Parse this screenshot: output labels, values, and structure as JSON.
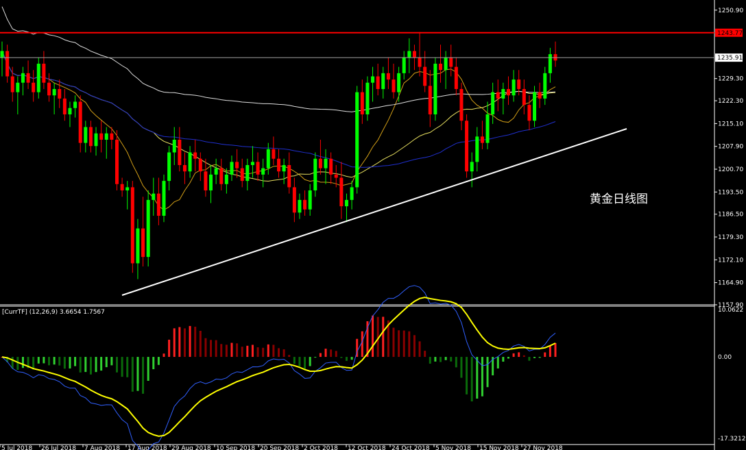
{
  "chart_data": [
    {
      "type": "candlestick",
      "annotation": "黄金日线图",
      "y_ticks": [
        "1250.90",
        "1243.77",
        "1235.91",
        "1229.30",
        "1222.30",
        "1215.10",
        "1207.90",
        "1200.70",
        "1193.50",
        "1186.50",
        "1179.30",
        "1172.10",
        "1164.90",
        "1157.90"
      ],
      "ylim": [
        1157.9,
        1254.1
      ],
      "resistance_level": 1243.77,
      "resistance_label": "1243.77",
      "current_price": 1235.91,
      "current_label": "1235.91",
      "x_labels": [
        "5 Jul 2018",
        "26 Jul 2018",
        "7 Aug 2018",
        "17 Aug 2018",
        "29 Aug 2018",
        "10 Sep 2018",
        "20 Sep 2018",
        "2 Oct 2018",
        "12 Oct 2018",
        "24 Oct 2018",
        "5 Nov 2018",
        "15 Nov 2018",
        "27 Nov 2018"
      ],
      "candles": [
        [
          1236,
          1241,
          1230,
          1238
        ],
        [
          1238,
          1240,
          1228,
          1230
        ],
        [
          1230,
          1233,
          1222,
          1225
        ],
        [
          1225,
          1230,
          1218,
          1228
        ],
        [
          1228,
          1233,
          1224,
          1231
        ],
        [
          1231,
          1235,
          1226,
          1228
        ],
        [
          1228,
          1232,
          1222,
          1225
        ],
        [
          1225,
          1236,
          1223,
          1234
        ],
        [
          1234,
          1238,
          1226,
          1228
        ],
        [
          1228,
          1231,
          1222,
          1224
        ],
        [
          1224,
          1228,
          1218,
          1226
        ],
        [
          1226,
          1229,
          1220,
          1223
        ],
        [
          1223,
          1226,
          1216,
          1218
        ],
        [
          1218,
          1222,
          1214,
          1220
        ],
        [
          1220,
          1224,
          1217,
          1222
        ],
        [
          1222,
          1224,
          1206,
          1209
        ],
        [
          1209,
          1216,
          1206,
          1214
        ],
        [
          1214,
          1216,
          1206,
          1208
        ],
        [
          1208,
          1214,
          1205,
          1212
        ],
        [
          1212,
          1216,
          1206,
          1210
        ],
        [
          1210,
          1214,
          1204,
          1212
        ],
        [
          1212,
          1214,
          1207,
          1210
        ],
        [
          1210,
          1213,
          1194,
          1196
        ],
        [
          1196,
          1198,
          1192,
          1194
        ],
        [
          1194,
          1197,
          1188,
          1195
        ],
        [
          1195,
          1197,
          1168,
          1171
        ],
        [
          1171,
          1185,
          1166,
          1182
        ],
        [
          1182,
          1192,
          1170,
          1173
        ],
        [
          1173,
          1194,
          1170,
          1191
        ],
        [
          1191,
          1198,
          1186,
          1193
        ],
        [
          1193,
          1198,
          1183,
          1186
        ],
        [
          1186,
          1199,
          1184,
          1197
        ],
        [
          1197,
          1208,
          1194,
          1206
        ],
        [
          1206,
          1214,
          1202,
          1210
        ],
        [
          1210,
          1214,
          1200,
          1202
        ],
        [
          1202,
          1206,
          1196,
          1200
        ],
        [
          1200,
          1208,
          1198,
          1206
        ],
        [
          1206,
          1210,
          1200,
          1204
        ],
        [
          1204,
          1206,
          1197,
          1200
        ],
        [
          1200,
          1204,
          1192,
          1194
        ],
        [
          1194,
          1202,
          1190,
          1199
        ],
        [
          1199,
          1204,
          1196,
          1201
        ],
        [
          1201,
          1204,
          1194,
          1196
        ],
        [
          1196,
          1201,
          1193,
          1199
        ],
        [
          1199,
          1205,
          1197,
          1203
        ],
        [
          1203,
          1207,
          1198,
          1201
        ],
        [
          1201,
          1204,
          1195,
          1197
        ],
        [
          1197,
          1204,
          1194,
          1202
        ],
        [
          1202,
          1208,
          1198,
          1203
        ],
        [
          1203,
          1206,
          1197,
          1199
        ],
        [
          1199,
          1204,
          1195,
          1201
        ],
        [
          1201,
          1209,
          1199,
          1207
        ],
        [
          1207,
          1211,
          1202,
          1204
        ],
        [
          1204,
          1207,
          1198,
          1200
        ],
        [
          1200,
          1204,
          1196,
          1202
        ],
        [
          1202,
          1206,
          1193,
          1195
        ],
        [
          1195,
          1198,
          1184,
          1187
        ],
        [
          1187,
          1193,
          1185,
          1191
        ],
        [
          1191,
          1194,
          1186,
          1188
        ],
        [
          1188,
          1196,
          1186,
          1194
        ],
        [
          1194,
          1206,
          1192,
          1204
        ],
        [
          1204,
          1210,
          1199,
          1201
        ],
        [
          1201,
          1207,
          1196,
          1204
        ],
        [
          1204,
          1206,
          1196,
          1199
        ],
        [
          1199,
          1202,
          1195,
          1198
        ],
        [
          1198,
          1203,
          1185,
          1189
        ],
        [
          1189,
          1193,
          1184,
          1191
        ],
        [
          1191,
          1197,
          1188,
          1195
        ],
        [
          1195,
          1227,
          1193,
          1225
        ],
        [
          1225,
          1229,
          1215,
          1218
        ],
        [
          1218,
          1230,
          1216,
          1228
        ],
        [
          1228,
          1233,
          1222,
          1230
        ],
        [
          1230,
          1234,
          1224,
          1226
        ],
        [
          1226,
          1233,
          1223,
          1231
        ],
        [
          1231,
          1236,
          1226,
          1229
        ],
        [
          1229,
          1234,
          1223,
          1225
        ],
        [
          1225,
          1233,
          1222,
          1231
        ],
        [
          1231,
          1238,
          1229,
          1236
        ],
        [
          1236,
          1242,
          1231,
          1238
        ],
        [
          1238,
          1240,
          1232,
          1236
        ],
        [
          1236,
          1244,
          1230,
          1233
        ],
        [
          1233,
          1238,
          1225,
          1227
        ],
        [
          1227,
          1232,
          1214,
          1218
        ],
        [
          1218,
          1236,
          1216,
          1234
        ],
        [
          1234,
          1240,
          1228,
          1232
        ],
        [
          1232,
          1238,
          1226,
          1236
        ],
        [
          1236,
          1240,
          1230,
          1233
        ],
        [
          1233,
          1236,
          1224,
          1226
        ],
        [
          1226,
          1228,
          1213,
          1216
        ],
        [
          1216,
          1218,
          1198,
          1200
        ],
        [
          1200,
          1206,
          1195,
          1203
        ],
        [
          1203,
          1214,
          1200,
          1211
        ],
        [
          1211,
          1216,
          1207,
          1209
        ],
        [
          1209,
          1222,
          1207,
          1218
        ],
        [
          1218,
          1228,
          1215,
          1225
        ],
        [
          1225,
          1229,
          1219,
          1223
        ],
        [
          1223,
          1228,
          1218,
          1226
        ],
        [
          1226,
          1230,
          1221,
          1224
        ],
        [
          1224,
          1232,
          1222,
          1229
        ],
        [
          1229,
          1232,
          1224,
          1226
        ],
        [
          1226,
          1229,
          1218,
          1221
        ],
        [
          1221,
          1224,
          1213,
          1216
        ],
        [
          1216,
          1227,
          1214,
          1225
        ],
        [
          1225,
          1228,
          1220,
          1223
        ],
        [
          1223,
          1233,
          1221,
          1231
        ],
        [
          1231,
          1239,
          1228,
          1237
        ],
        [
          1237,
          1241,
          1233,
          1235
        ]
      ],
      "macd_label": "[CurrTF] (12,26,9) 3.6654 1.7567",
      "macd_ticks": [
        "10.0622",
        "0.00",
        "-17.3212"
      ],
      "macd_ylim": [
        -17.3212,
        10.0622
      ]
    }
  ]
}
